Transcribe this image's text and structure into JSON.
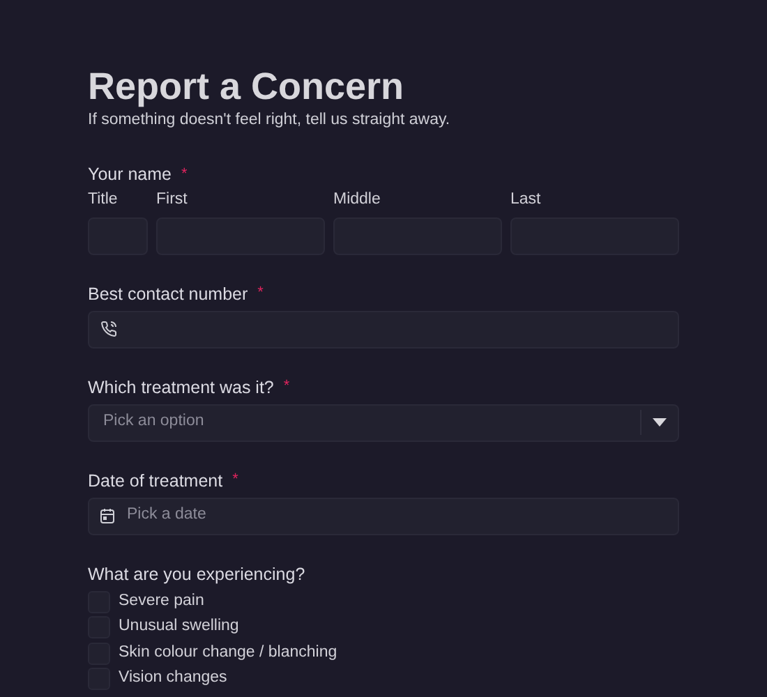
{
  "title": "Report a Concern",
  "subtitle": "If something doesn't feel right, tell us straight away.",
  "name_field": {
    "label": "Your name",
    "required_mark": "*",
    "parts": [
      {
        "label": "Title"
      },
      {
        "label": "First"
      },
      {
        "label": "Middle"
      },
      {
        "label": "Last"
      }
    ]
  },
  "contact_field": {
    "label": "Best contact number",
    "required_mark": "*"
  },
  "treatment_field": {
    "label": "Which treatment was it?",
    "required_mark": "*",
    "placeholder": "Pick an option"
  },
  "date_field": {
    "label": "Date of treatment",
    "required_mark": "*",
    "placeholder": "Pick a date"
  },
  "symptoms": {
    "label": "What are you experiencing?",
    "options": [
      {
        "label": "Severe pain",
        "checked": false
      },
      {
        "label": "Unusual swelling",
        "checked": false
      },
      {
        "label": "Skin colour change / blanching",
        "checked": false
      },
      {
        "label": "Vision changes",
        "checked": false
      }
    ]
  }
}
